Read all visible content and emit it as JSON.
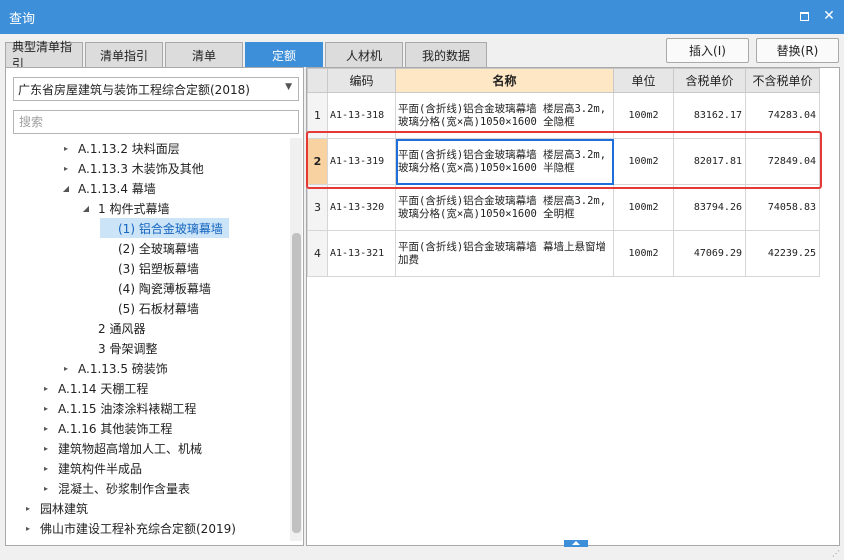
{
  "window": {
    "title": "查询"
  },
  "tabs": [
    {
      "label": "典型清单指引"
    },
    {
      "label": "清单指引"
    },
    {
      "label": "清单"
    },
    {
      "label": "定额",
      "active": true
    },
    {
      "label": "人材机"
    },
    {
      "label": "我的数据"
    }
  ],
  "actions": {
    "insert": "插入(I)",
    "replace": "替换(R)"
  },
  "left": {
    "library": "广东省房屋建筑与装饰工程综合定额(2018)",
    "search_placeholder": "搜索",
    "tree": [
      {
        "label": "A.1.13.2 块料面层",
        "toggle": "▸",
        "level": 3
      },
      {
        "label": "A.1.13.3 木装饰及其他",
        "toggle": "▸",
        "level": 3
      },
      {
        "label": "A.1.13.4 幕墙",
        "toggle": "◢",
        "level": 3
      },
      {
        "label": "1 构件式幕墙",
        "toggle": "◢",
        "level": 4
      },
      {
        "label": "(1) 铝合金玻璃幕墙",
        "toggle": "",
        "level": 5,
        "selected": true
      },
      {
        "label": "(2) 全玻璃幕墙",
        "toggle": "",
        "level": 5
      },
      {
        "label": "(3) 铝塑板幕墙",
        "toggle": "",
        "level": 5
      },
      {
        "label": "(4) 陶瓷薄板幕墙",
        "toggle": "",
        "level": 5
      },
      {
        "label": "(5) 石板材幕墙",
        "toggle": "",
        "level": 5
      },
      {
        "label": "2 通风器",
        "toggle": "",
        "level": 4
      },
      {
        "label": "3 骨架调整",
        "toggle": "",
        "level": 4
      },
      {
        "label": "A.1.13.5 磅装饰",
        "toggle": "▸",
        "level": 3
      },
      {
        "label": "A.1.14 天棚工程",
        "toggle": "▸",
        "level": 2
      },
      {
        "label": "A.1.15 油漆涂料裱糊工程",
        "toggle": "▸",
        "level": 2
      },
      {
        "label": "A.1.16 其他装饰工程",
        "toggle": "▸",
        "level": 2
      },
      {
        "label": "建筑物超高增加人工、机械",
        "toggle": "▸",
        "level": 2
      },
      {
        "label": "建筑构件半成品",
        "toggle": "▸",
        "level": 2
      },
      {
        "label": "混凝土、砂浆制作含量表",
        "toggle": "▸",
        "level": 2
      },
      {
        "label": "园林建筑",
        "toggle": "▸",
        "level": 1
      },
      {
        "label": "佛山市建设工程补充综合定额(2019)",
        "toggle": "▸",
        "level": 1
      }
    ]
  },
  "grid": {
    "headers": {
      "idx": "",
      "code": "编码",
      "name": "名称",
      "unit": "单位",
      "tax": "含税单价",
      "notax": "不含税单价"
    },
    "rows": [
      {
        "idx": "1",
        "code": "A1-13-318",
        "name": "平面(含折线)铝合金玻璃幕墙 楼层高3.2m,玻璃分格(宽×高)1050×1600 全隐框",
        "unit": "100m2",
        "tax": "83162.17",
        "notax": "74283.04"
      },
      {
        "idx": "2",
        "code": "A1-13-319",
        "name": "平面(含折线)铝合金玻璃幕墙 楼层高3.2m,玻璃分格(宽×高)1050×1600 半隐框",
        "unit": "100m2",
        "tax": "82017.81",
        "notax": "72849.04",
        "current": true
      },
      {
        "idx": "3",
        "code": "A1-13-320",
        "name": "平面(含折线)铝合金玻璃幕墙 楼层高3.2m,玻璃分格(宽×高)1050×1600 全明框",
        "unit": "100m2",
        "tax": "83794.26",
        "notax": "74058.83"
      },
      {
        "idx": "4",
        "code": "A1-13-321",
        "name": "平面(含折线)铝合金玻璃幕墙 幕墙上悬窗增加费",
        "unit": "100m2",
        "tax": "47069.29",
        "notax": "42239.25"
      }
    ]
  }
}
